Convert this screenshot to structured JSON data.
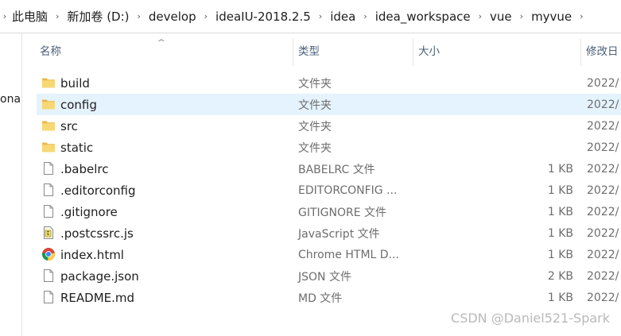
{
  "breadcrumb": [
    "此电脑",
    "新加卷 (D:)",
    "develop",
    "ideaIU-2018.2.5",
    "idea",
    "idea_workspace",
    "vue",
    "myvue"
  ],
  "nav_fragment": "ona",
  "columns": {
    "name": "名称",
    "type": "类型",
    "size": "大小",
    "date": "修改日"
  },
  "rows": [
    {
      "icon": "folder-icon",
      "name": "build",
      "type": "文件夹",
      "size": "",
      "date": "2022/"
    },
    {
      "icon": "folder-icon",
      "name": "config",
      "type": "文件夹",
      "size": "",
      "date": "2022/",
      "selected": true
    },
    {
      "icon": "folder-icon",
      "name": "src",
      "type": "文件夹",
      "size": "",
      "date": "2022/"
    },
    {
      "icon": "folder-icon",
      "name": "static",
      "type": "文件夹",
      "size": "",
      "date": "2022/"
    },
    {
      "icon": "file-icon",
      "name": ".babelrc",
      "type": "BABELRC 文件",
      "size": "1 KB",
      "date": "2022/"
    },
    {
      "icon": "file-icon",
      "name": ".editorconfig",
      "type": "EDITORCONFIG ...",
      "size": "1 KB",
      "date": "2022/"
    },
    {
      "icon": "file-icon",
      "name": ".gitignore",
      "type": "GITIGNORE 文件",
      "size": "1 KB",
      "date": "2022/"
    },
    {
      "icon": "javascript-file-icon",
      "name": ".postcssrc.js",
      "type": "JavaScript 文件",
      "size": "1 KB",
      "date": "2022/"
    },
    {
      "icon": "chrome-icon",
      "name": "index.html",
      "type": "Chrome HTML D...",
      "size": "1 KB",
      "date": "2022/"
    },
    {
      "icon": "file-icon",
      "name": "package.json",
      "type": "JSON 文件",
      "size": "2 KB",
      "date": "2022/"
    },
    {
      "icon": "file-icon",
      "name": "README.md",
      "type": "MD 文件",
      "size": "1 KB",
      "date": "2022/"
    }
  ],
  "watermark": "CSDN @Daniel521-Spark",
  "colors": {
    "selected_row": "#e5f3ff",
    "folder": "#f8d775",
    "header_text": "#4c607a"
  }
}
